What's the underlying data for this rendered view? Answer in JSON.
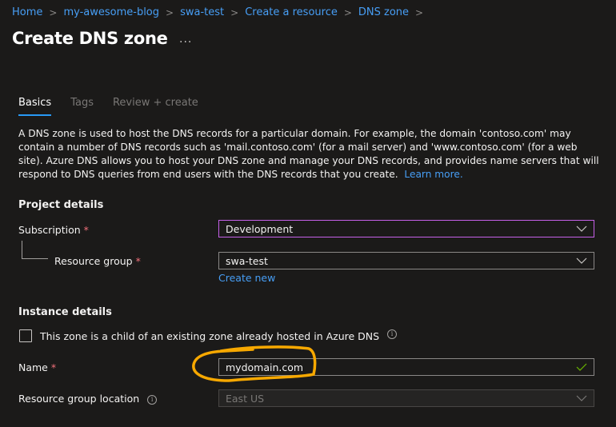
{
  "breadcrumb": {
    "items": [
      "Home",
      "my-awesome-blog",
      "swa-test",
      "Create a resource",
      "DNS zone"
    ],
    "separator": ">"
  },
  "header": {
    "title": "Create DNS zone",
    "more_icon": "..."
  },
  "tabs": [
    {
      "label": "Basics",
      "active": true
    },
    {
      "label": "Tags",
      "active": false
    },
    {
      "label": "Review + create",
      "active": false
    }
  ],
  "description": {
    "text": "A DNS zone is used to host the DNS records for a particular domain. For example, the domain 'contoso.com' may contain a number of DNS records such as 'mail.contoso.com' (for a mail server) and 'www.contoso.com' (for a web site). Azure DNS allows you to host your DNS zone and manage your DNS records, and provides name servers that will respond to DNS queries from end users with the DNS records that you create.",
    "learn_more": "Learn more."
  },
  "project_details": {
    "heading": "Project details",
    "subscription": {
      "label": "Subscription",
      "required": "*",
      "value": "Development"
    },
    "resource_group": {
      "label": "Resource group",
      "required": "*",
      "value": "swa-test",
      "create_new": "Create new"
    }
  },
  "instance_details": {
    "heading": "Instance details",
    "child_zone": {
      "label": "This zone is a child of an existing zone already hosted in Azure DNS",
      "checked": false,
      "info_icon": "i"
    },
    "name": {
      "label": "Name",
      "required": "*",
      "value": "mydomain.com",
      "valid": true
    },
    "location": {
      "label": "Resource group location",
      "info_icon": "i",
      "value": "East US",
      "disabled": true
    }
  },
  "annotation": {
    "color": "#f7a800",
    "target": "name-input"
  },
  "colors": {
    "accent": "#2899f5",
    "link": "#479ef5",
    "focus_border": "#c560e8",
    "required": "#f1707b",
    "valid": "#6bb700"
  }
}
